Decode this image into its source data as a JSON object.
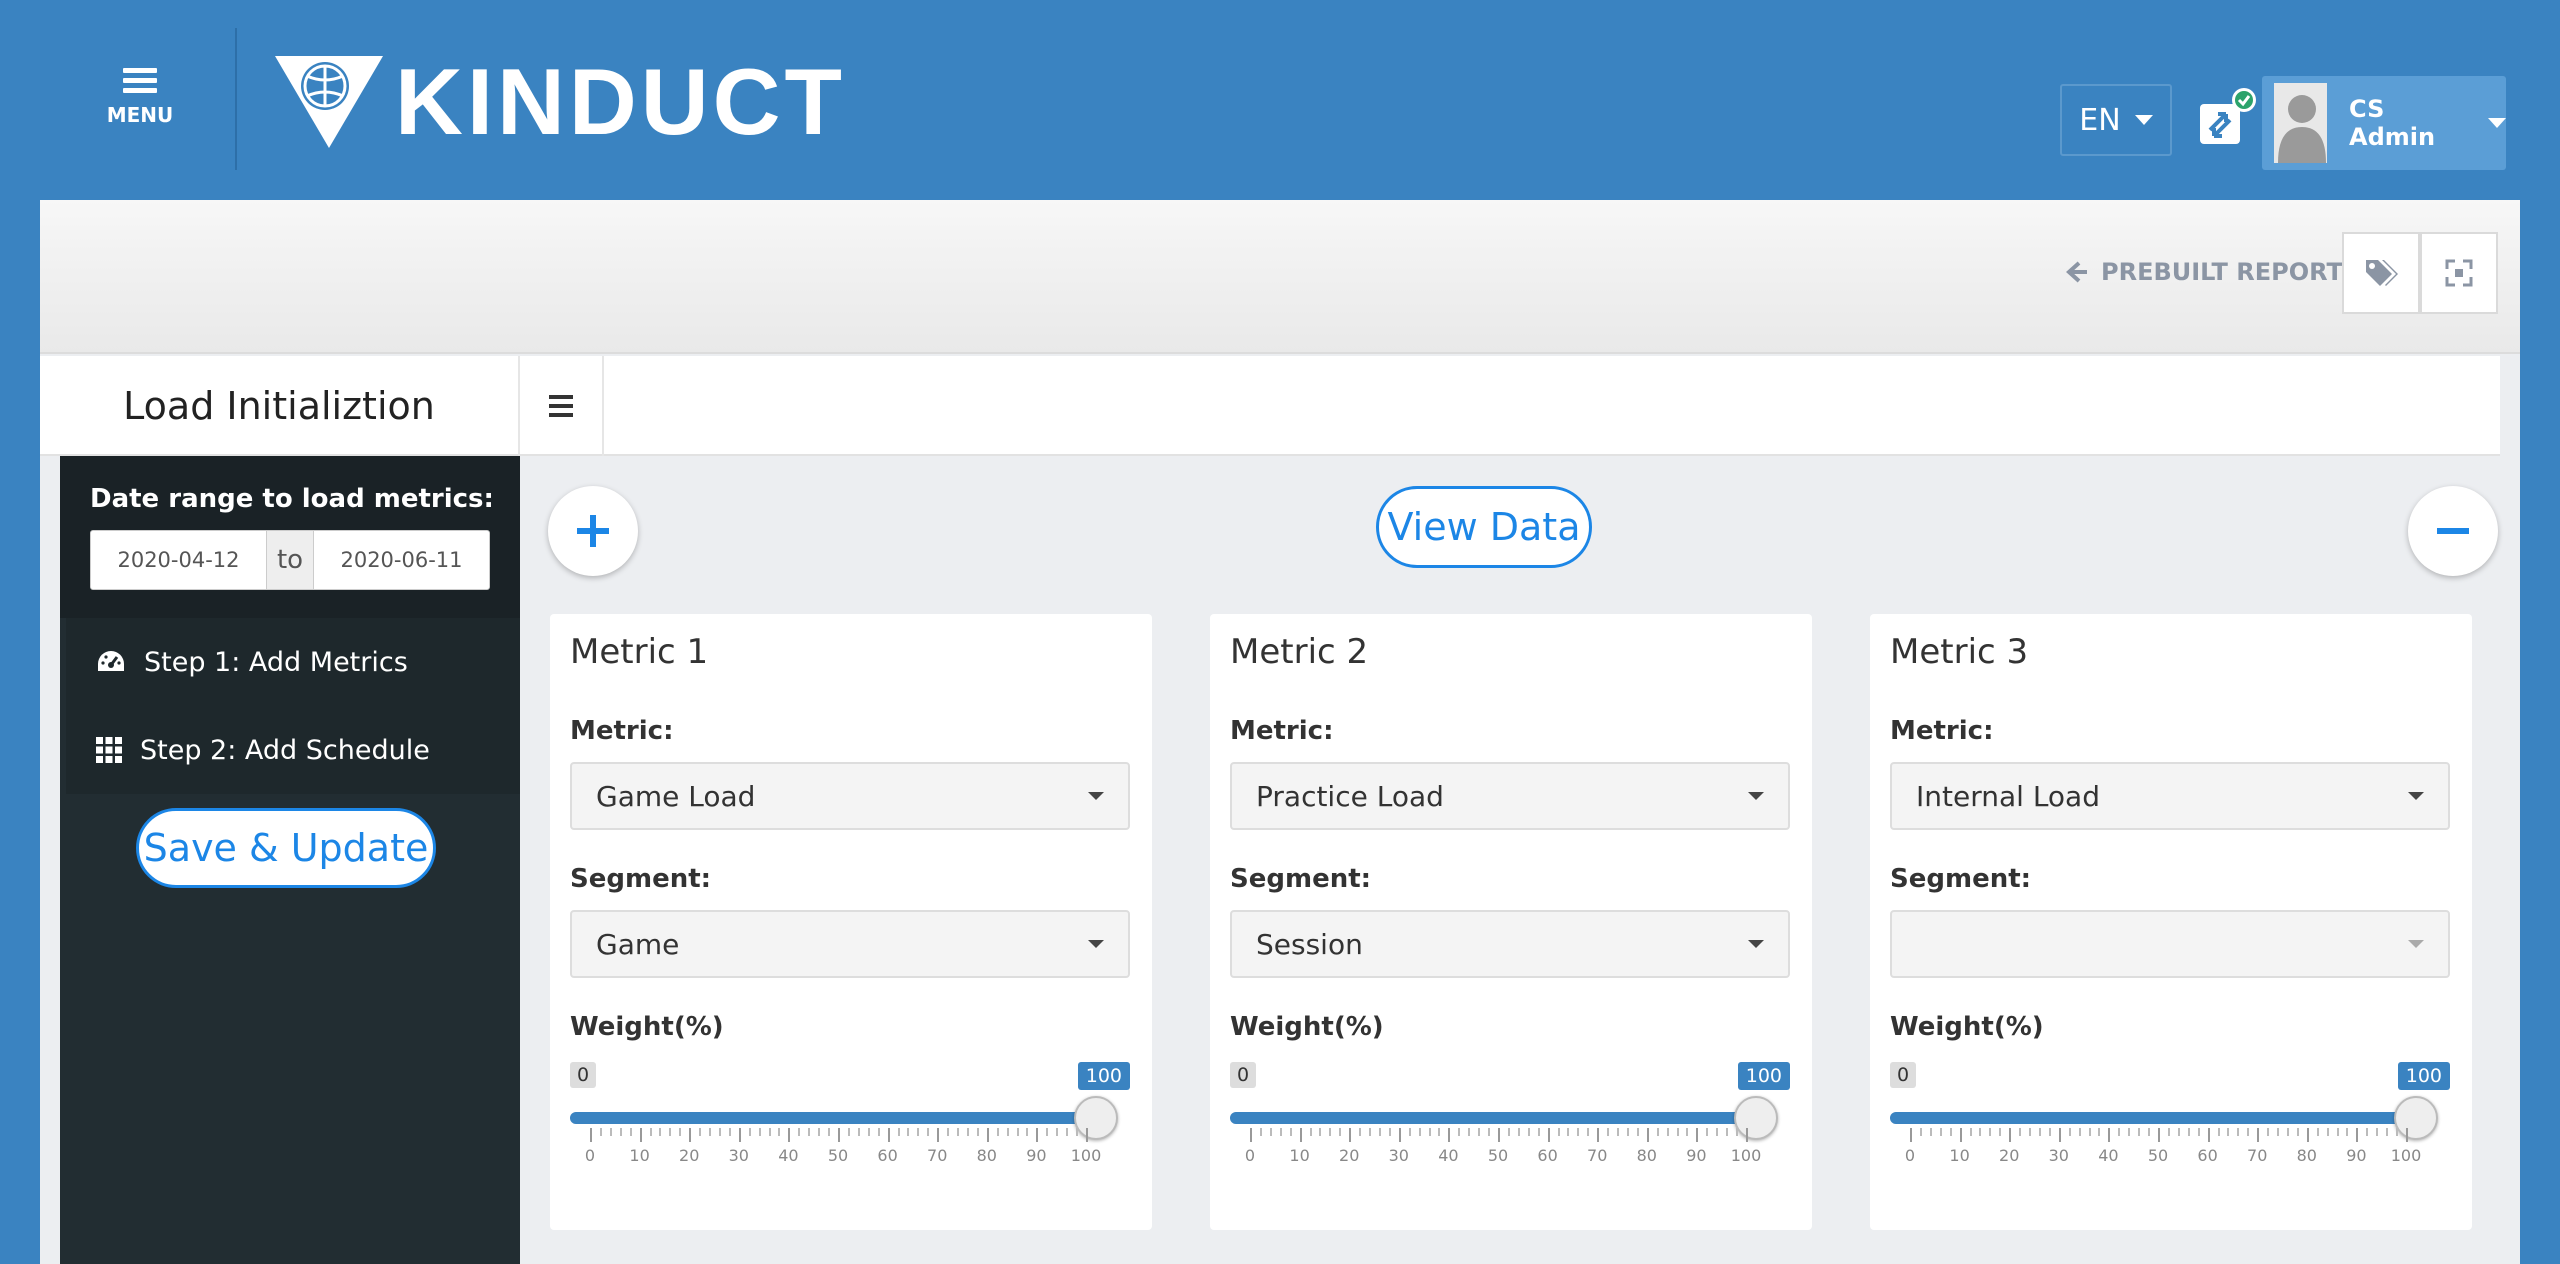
{
  "topbar": {
    "menu_label": "MENU",
    "logo_text": "KINDUCT",
    "language": "EN",
    "user_name": "CS Admin"
  },
  "toolbar": {
    "prebuilt_reports": "PREBUILT REPORTS"
  },
  "page": {
    "title": "Load Initializtion"
  },
  "sidebar": {
    "date_range_label": "Date range to load metrics:",
    "start_date": "2020-04-12",
    "to_label": "to",
    "end_date": "2020-06-11",
    "steps": [
      {
        "label": "Step 1: Add Metrics",
        "icon": "dashboard-icon"
      },
      {
        "label": "Step 2: Add Schedule",
        "icon": "grid-icon"
      }
    ],
    "save_button": "Save & Update"
  },
  "content": {
    "view_data_button": "View Data",
    "metric_label": "Metric:",
    "segment_label": "Segment:",
    "weight_label": "Weight(%)",
    "cards": [
      {
        "title": "Metric 1",
        "metric": "Game Load",
        "segment": "Game",
        "weight_min": "0",
        "weight_max": "100",
        "weight_value": 100
      },
      {
        "title": "Metric 2",
        "metric": "Practice Load",
        "segment": "Session",
        "weight_min": "0",
        "weight_max": "100",
        "weight_value": 100
      },
      {
        "title": "Metric 3",
        "metric": "Internal Load",
        "segment": "",
        "weight_min": "0",
        "weight_max": "100",
        "weight_value": 100
      }
    ],
    "tick_labels": [
      "0",
      "10",
      "20",
      "30",
      "40",
      "50",
      "60",
      "70",
      "80",
      "90",
      "100"
    ]
  },
  "colors": {
    "brand_blue": "#3a83c1",
    "accent_blue": "#1c86e6",
    "sidebar_dark": "#222d32"
  }
}
